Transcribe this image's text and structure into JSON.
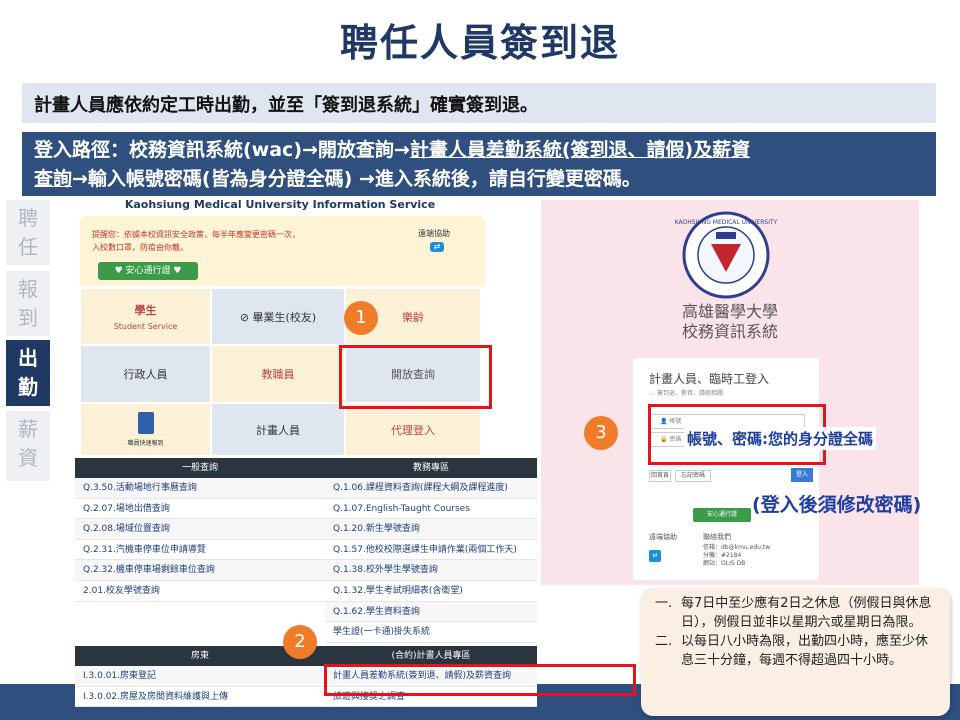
{
  "title": "聘任人員簽到退",
  "intro": "計畫人員應依約定工時出勤，並至「簽到退系統」確實簽到退。",
  "path": {
    "prefix": "登入路徑：校務資訊系統(wac)→開放查詢→",
    "link1": "計畫人員差勤系統(簽到退、請假)及薪資",
    "link2": "查詢",
    "suffix": "→輸入帳號密碼(皆為身分證全碼) →進入系統後，請自行變更密碼。"
  },
  "sidebar": [
    {
      "label": "聘任",
      "active": false
    },
    {
      "label": "報到",
      "active": false
    },
    {
      "label": "出勤",
      "active": true
    },
    {
      "label": "薪資",
      "active": false
    }
  ],
  "wac": {
    "header": "Kaohsiung Medical University Information Service",
    "notice_line1": "提醒您：依據本校資訊安全政策，每半年應變更密碼一次，",
    "notice_line2": "入校數口罩，防疫由你戴。",
    "support_label": "遠端協助",
    "safe_button": "♥ 安心通行證 ♥",
    "cells": {
      "student": "學生",
      "student_en": "Student Service",
      "alumni": "⊘ 畢業生(校友)",
      "age": "樂齡",
      "admin": "行政人員",
      "staff": "教職員",
      "open_query": "開放查詢",
      "badge_caption": "職員快速報到",
      "project": "計畫人員",
      "proxy_login": "代理登入"
    }
  },
  "table": {
    "general_header": "一般查詢",
    "academic_header": "教務專區",
    "general_rows": [
      "Q.3.50.活動場地行事曆查詢",
      "Q.2.07.場地出借查詢",
      "Q.2.08.場域位置查詢",
      "Q.2.31.汽機車停車位申請導覽",
      "Q.2.32.機車停車場剩餘車位查詢",
      "2.01.校友學號查詢"
    ],
    "academic_rows": [
      "Q.1.06.課程資料查詢(課程大綱及課程進度)",
      "Q.1.07.English-Taught Courses",
      "Q.1.20.新生學號查詢",
      "Q.1.57.他校校際選課生申請作業(兩個工作天)",
      "Q.1.38.校外學生學號查詢",
      "Q.1.32.學生考試明細表(含衛堂)",
      "Q.1.62.學生資料查詢",
      "學生證(一卡通)掛失系統"
    ],
    "landlord_header": "房東",
    "project_header": "(合約)計畫人員專區",
    "landlord_rows": [
      "I.3.0.01.房東登記",
      "I.3.0.02.房屋及房間資料維護與上傳"
    ],
    "project_rows": [
      "計畫人員差勤系統(簽到退、請假)及薪資查詢",
      "旅遊與接獎之調查"
    ]
  },
  "login": {
    "uni_line1": "高雄醫學大學",
    "uni_line2": "校務資訊系統",
    "logo_text": "KAOHSIUNG MEDICAL UNIVERSITY",
    "title": "計畫人員、臨時工登入",
    "subtitle": "::: 簽到退、薪資、請假相關",
    "account_placeholder": "帳號",
    "password_placeholder": "密碼",
    "home_button": "回首頁",
    "forgot_button": "忘記密碼",
    "login_button": "登入",
    "safe_button": "安心通行證",
    "help_label": "遠端協助",
    "contact_label": "聯絡我們",
    "contact_email": "信箱：db@kmu.edu.tw",
    "contact_ext": "分機：#2184",
    "contact_site": "網站：OLIS DB"
  },
  "annotations": {
    "badge1": "1",
    "badge2": "2",
    "badge3": "3",
    "credentials": "帳號、密碼:您的身分證全碼",
    "change_password": "(登入後須修改密碼)"
  },
  "rules": [
    {
      "num": "一.",
      "text": "每7日中至少應有2日之休息（例假日與休息日），例假日並非以星期六或星期日為限。"
    },
    {
      "num": "二.",
      "text": "以每日八小時為限，出勤四小時，應至少休息三十分鐘，每週不得超過四十小時。"
    }
  ],
  "colors": {
    "title": "#1f3864",
    "path_bar": "#2f4f7f",
    "highlight": "#e3141b",
    "badge": "#f07c2a",
    "note": "#1f3f9f"
  }
}
